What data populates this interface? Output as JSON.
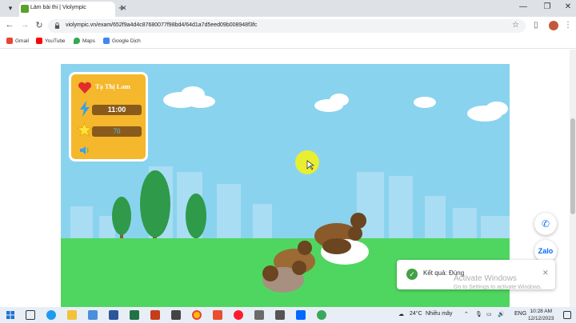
{
  "browser": {
    "tab_title": "Làm bài thi | Violympic",
    "url": "violympic.vn/exam/652f9a4d4c87680077f98bd4/64d1a7d5eed09b008948f3fc",
    "bookmarks": [
      "Gmail",
      "YouTube",
      "Maps",
      "Google Dịch"
    ],
    "colors": {
      "tab_strip": "#dee1e6",
      "omnibox": "#f1f3f4"
    }
  },
  "game": {
    "player_name": "Tạ Thị Lam",
    "timer": "11:00",
    "score": "70",
    "icons": [
      "heart-icon",
      "lightning-icon",
      "star-icon",
      "speaker-icon"
    ],
    "colors": {
      "sky": "#8ad3ee",
      "ground": "#4fd660",
      "panel": "#f5b82c"
    }
  },
  "toast": {
    "text": "Kết quả: Đúng"
  },
  "watermark": {
    "line1": "Activate Windows",
    "line2": "Go to Settings to activate Windows."
  },
  "fab": {
    "zalo": "Zalo"
  },
  "taskbar": {
    "weather": "24°C",
    "weather_desc": "Nhiều mây",
    "lang": "ENG",
    "time": "10:28 AM",
    "date": "12/12/2023"
  }
}
